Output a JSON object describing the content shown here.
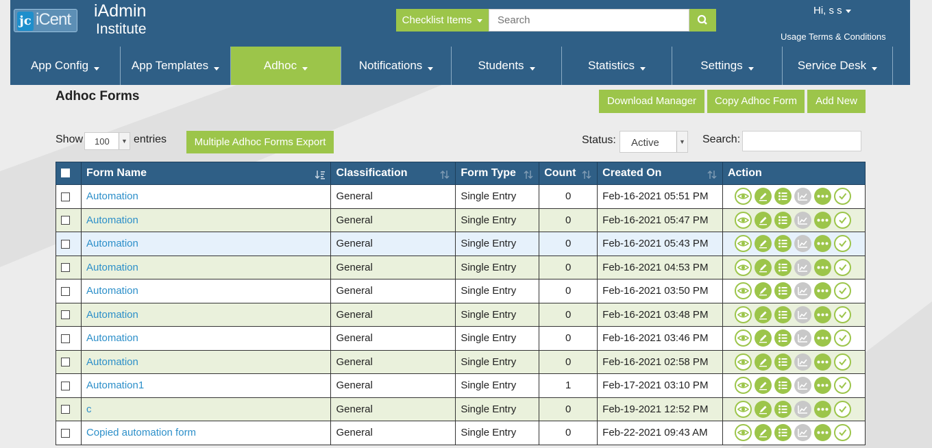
{
  "header": {
    "logo_text": "iCent",
    "brand_line1": "iAdmin",
    "brand_line2": "Institute",
    "checklist_label": "Checklist Items",
    "search_placeholder": "Search",
    "greeting": "Hi, s s",
    "terms_link": "Usage Terms & Conditions"
  },
  "nav": {
    "items": [
      {
        "label": "App Config"
      },
      {
        "label": "App Templates"
      },
      {
        "label": "Adhoc"
      },
      {
        "label": "Notifications"
      },
      {
        "label": "Students"
      },
      {
        "label": "Statistics"
      },
      {
        "label": "Settings"
      },
      {
        "label": "Service Desk"
      }
    ],
    "active": "Adhoc"
  },
  "page": {
    "title": "Adhoc Forms",
    "buttons": {
      "download_manager": "Download Manager",
      "copy_form": "Copy Adhoc Form",
      "add_new": "Add New",
      "export": "Multiple Adhoc Forms Export"
    },
    "show_label": "Show",
    "entries_value": "100",
    "entries_label": "entries",
    "status_label": "Status:",
    "status_value": "Active",
    "search_label": "Search:"
  },
  "table": {
    "columns": {
      "form_name": "Form Name",
      "classification": "Classification",
      "form_type": "Form Type",
      "count": "Count",
      "created_on": "Created On",
      "action": "Action"
    },
    "rows": [
      {
        "name": "Automation",
        "classification": "General",
        "type": "Single Entry",
        "count": "0",
        "created": "Feb-16-2021 05:51 PM"
      },
      {
        "name": "Automation",
        "classification": "General",
        "type": "Single Entry",
        "count": "0",
        "created": "Feb-16-2021 05:47 PM"
      },
      {
        "name": "Automation",
        "classification": "General",
        "type": "Single Entry",
        "count": "0",
        "created": "Feb-16-2021 05:43 PM"
      },
      {
        "name": "Automation",
        "classification": "General",
        "type": "Single Entry",
        "count": "0",
        "created": "Feb-16-2021 04:53 PM"
      },
      {
        "name": "Automation",
        "classification": "General",
        "type": "Single Entry",
        "count": "0",
        "created": "Feb-16-2021 03:50 PM"
      },
      {
        "name": "Automation",
        "classification": "General",
        "type": "Single Entry",
        "count": "0",
        "created": "Feb-16-2021 03:48 PM"
      },
      {
        "name": "Automation",
        "classification": "General",
        "type": "Single Entry",
        "count": "0",
        "created": "Feb-16-2021 03:46 PM"
      },
      {
        "name": "Automation",
        "classification": "General",
        "type": "Single Entry",
        "count": "0",
        "created": "Feb-16-2021 02:58 PM"
      },
      {
        "name": "Automation1",
        "classification": "General",
        "type": "Single Entry",
        "count": "1",
        "created": "Feb-17-2021 03:10 PM"
      },
      {
        "name": "c",
        "classification": "General",
        "type": "Single Entry",
        "count": "0",
        "created": "Feb-19-2021 12:52 PM"
      },
      {
        "name": "Copied automation form",
        "classification": "General",
        "type": "Single Entry",
        "count": "0",
        "created": "Feb-22-2021 09:43 AM"
      }
    ],
    "row_actions": [
      "view-icon",
      "edit-icon",
      "list-icon",
      "chart-icon",
      "more-icon",
      "approve-icon"
    ]
  },
  "colors": {
    "header_blue": "#2f5f86",
    "accent_green": "#9cc54a",
    "link_blue": "#2c8fc9",
    "row_alt": "#eaf1dc"
  }
}
